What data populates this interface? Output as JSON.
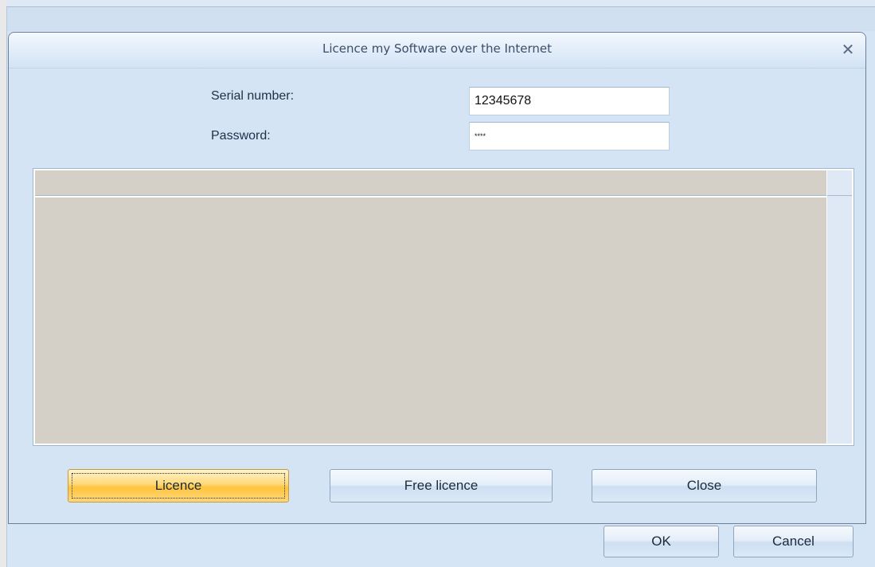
{
  "dialog": {
    "title": "Licence my Software over the Internet",
    "close_glyph": "✕"
  },
  "form": {
    "serial_label": "Serial number:",
    "serial_value": "12345678",
    "password_label": "Password:",
    "password_value": "****"
  },
  "buttons": {
    "licence": "Licence",
    "free_licence": "Free licence",
    "close": "Close"
  },
  "parent_buttons": {
    "ok": "OK",
    "cancel": "Cancel"
  },
  "icons": {
    "close": "close-icon"
  }
}
